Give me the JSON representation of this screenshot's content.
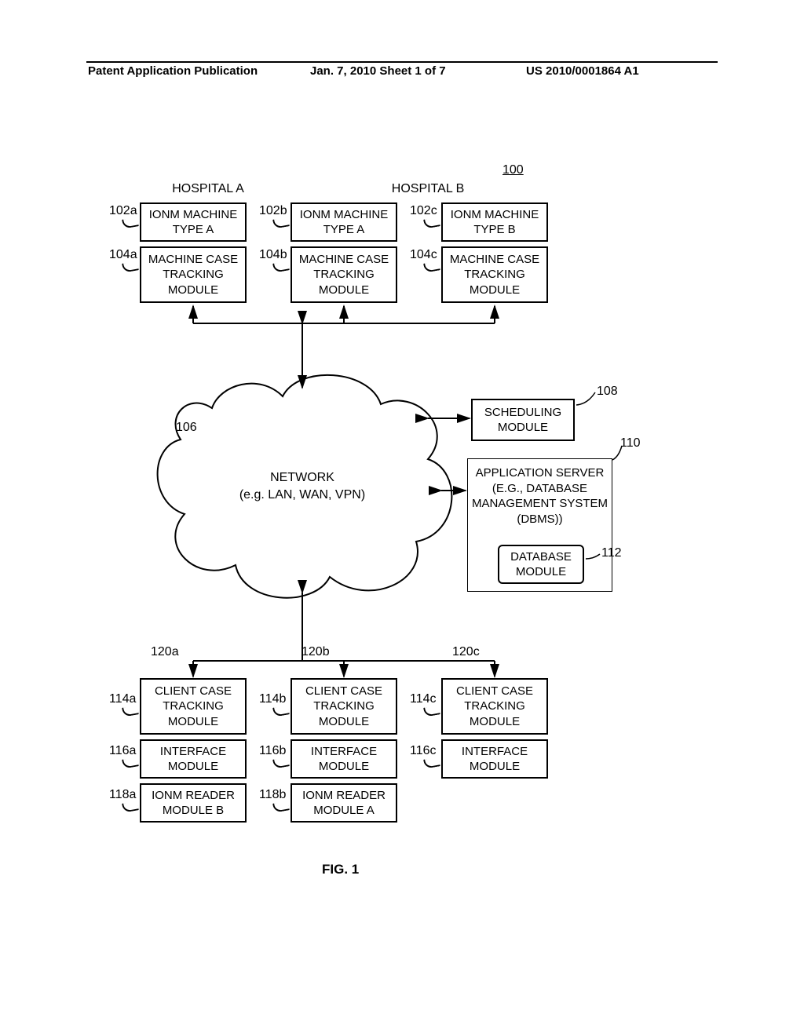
{
  "header": {
    "left": "Patent Application Publication",
    "mid": "Jan. 7, 2010  Sheet 1 of 7",
    "right": "US 2010/0001864 A1"
  },
  "hospitals": {
    "a": "HOSPITAL A",
    "b": "HOSPITAL B"
  },
  "figref": "100",
  "top": {
    "a": {
      "ionm": "IONM MACHINE\nTYPE A",
      "track": "MACHINE CASE\nTRACKING\nMODULE",
      "r1": "102a",
      "r2": "104a"
    },
    "b": {
      "ionm": "IONM MACHINE\nTYPE A",
      "track": "MACHINE CASE\nTRACKING\nMODULE",
      "r1": "102b",
      "r2": "104b"
    },
    "c": {
      "ionm": "IONM MACHINE\nTYPE B",
      "track": "MACHINE CASE\nTRACKING\nMODULE",
      "r1": "102c",
      "r2": "104c"
    }
  },
  "network": {
    "label": "NETWORK\n(e.g. LAN, WAN, VPN)",
    "ref": "106"
  },
  "sched": {
    "label": "SCHEDULING\nMODULE",
    "ref": "108"
  },
  "appserver": {
    "label": "APPLICATION SERVER\n(E.G., DATABASE\nMANAGEMENT SYSTEM\n(DBMS))",
    "ref": "110"
  },
  "db": {
    "label": "DATABASE\nMODULE",
    "ref": "112"
  },
  "client": {
    "r120": {
      "a": "120a",
      "b": "120b",
      "c": "120c"
    },
    "a": {
      "cct": "CLIENT CASE\nTRACKING\nMODULE",
      "if": "INTERFACE\nMODULE",
      "reader": "IONM READER\nMODULE B",
      "r1": "114a",
      "r2": "116a",
      "r3": "118a"
    },
    "b": {
      "cct": "CLIENT CASE\nTRACKING\nMODULE",
      "if": "INTERFACE\nMODULE",
      "reader": "IONM READER\nMODULE A",
      "r1": "114b",
      "r2": "116b",
      "r3": "118b"
    },
    "c": {
      "cct": "CLIENT CASE\nTRACKING\nMODULE",
      "if": "INTERFACE\nMODULE",
      "r1": "114c",
      "r2": "116c"
    }
  },
  "fig": "FIG. 1"
}
